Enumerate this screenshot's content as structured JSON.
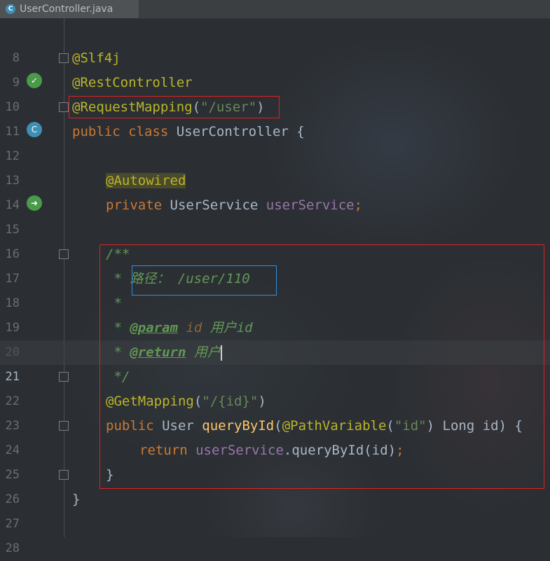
{
  "tab": {
    "label": "UserController.java",
    "icon": "class-c-icon"
  },
  "lines": {
    "l8": {
      "num": "8"
    },
    "l9": {
      "num": "9",
      "ann": "@Slf4j"
    },
    "l10": {
      "num": "10",
      "ann": "@RestController"
    },
    "l11": {
      "num": "11",
      "ann": "@RequestMapping",
      "p1": "(",
      "str": "\"/user\"",
      "p2": ")"
    },
    "l12": {
      "num": "12",
      "kw": "public class ",
      "id": "UserController {"
    },
    "l13": {
      "num": "13"
    },
    "l14": {
      "num": "14",
      "ann": "@Autowired"
    },
    "l15": {
      "num": "15",
      "kw": "private ",
      "type": "UserService ",
      "field": "userService",
      "semi": ";"
    },
    "l16": {
      "num": "16"
    },
    "l17": {
      "num": "17",
      "cmt": "/**"
    },
    "l18": {
      "num": "18",
      "cmt": " * 路径： /user/110"
    },
    "l19": {
      "num": "19",
      "cmt": " *"
    },
    "l20": {
      "num": "20",
      "star": " * ",
      "tag": "@param",
      "tagval": " id",
      "cmt": " 用户id"
    },
    "l21": {
      "num": "21",
      "star": " * ",
      "tag": "@return",
      "cmt": " 用户"
    },
    "l22": {
      "num": "22",
      "cmt": " */"
    },
    "l23": {
      "num": "23",
      "ann": "@GetMapping",
      "p1": "(",
      "str": "\"/{id}\"",
      "p2": ")"
    },
    "l24": {
      "num": "24",
      "kw": "public ",
      "type": "User ",
      "fn": "queryById",
      "p1": "(",
      "ann": "@PathVariable",
      "p2": "(",
      "str": "\"id\"",
      "p3": ") Long id) {"
    },
    "l25": {
      "num": "25",
      "kw": "return ",
      "field": "userService",
      "rest": ".queryById(id)",
      "semi": ";"
    },
    "l26": {
      "num": "26",
      "id": "}"
    },
    "l27": {
      "num": "27",
      "id": "}"
    },
    "l28": {
      "num": "28"
    }
  },
  "colors": {
    "highlight_red": "#e02020",
    "highlight_blue": "#2e8ee0"
  }
}
